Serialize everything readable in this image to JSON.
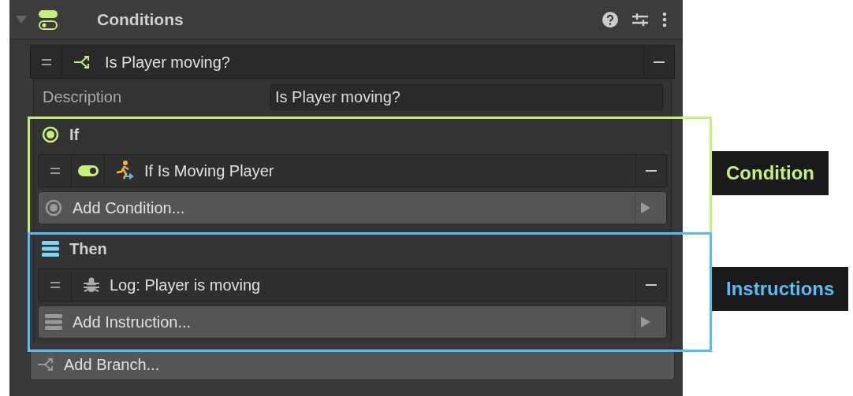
{
  "panel": {
    "title": "Conditions",
    "expanded": true
  },
  "branch": {
    "title": "Is Player moving?",
    "description_label": "Description",
    "description_value": "Is Player moving?"
  },
  "condition_section": {
    "heading": "If",
    "items": [
      {
        "title": "If Is Moving Player",
        "on": true
      }
    ],
    "add_label": "Add Condition..."
  },
  "instruction_section": {
    "heading": "Then",
    "items": [
      {
        "title": "Log: Player is moving"
      }
    ],
    "add_label": "Add Instruction..."
  },
  "add_branch": "Add Branch...",
  "annotations": [
    {
      "label": "Condition",
      "color": "#c5f07a"
    },
    {
      "label": "Instructions",
      "color": "#5bbcf5"
    }
  ]
}
